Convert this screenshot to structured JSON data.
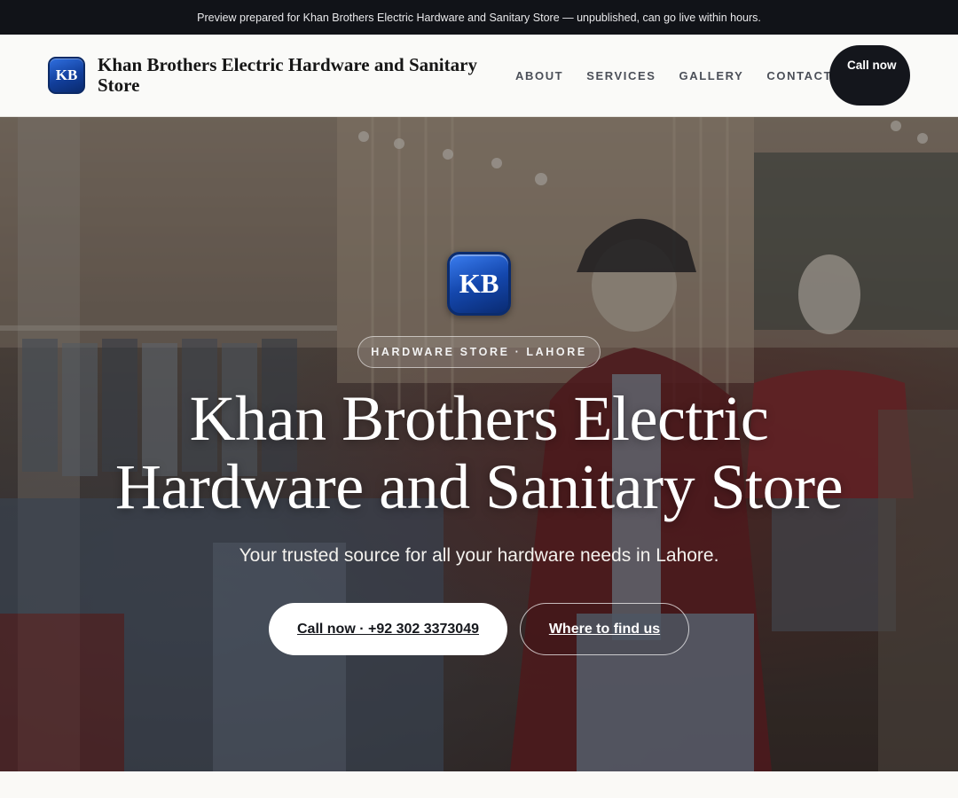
{
  "banner": {
    "text": "Preview prepared for Khan Brothers Electric Hardware and Sanitary Store — unpublished, can go live within hours."
  },
  "header": {
    "logo_initials": "KB",
    "brand_name": "Khan Brothers Electric Hardware and Sanitary Store",
    "nav": [
      "ABOUT",
      "SERVICES",
      "GALLERY",
      "CONTACT"
    ],
    "call_button": "Call now"
  },
  "hero": {
    "logo_initials": "KB",
    "tag": "HARDWARE STORE · LAHORE",
    "title": "Khan Brothers Electric Hardware and Sanitary Store",
    "subtitle": "Your trusted source for all your hardware needs in Lahore.",
    "primary_button": "Call now · +92 302 3373049",
    "secondary_button": "Where to find us",
    "background_image": "clothing-store-interior-with-mannequins"
  },
  "colors": {
    "banner_bg": "#111318",
    "header_bg": "#fafaf8",
    "call_pill_bg": "#14161c",
    "logo_blue": "#1447ad",
    "hero_text": "#ffffff"
  }
}
